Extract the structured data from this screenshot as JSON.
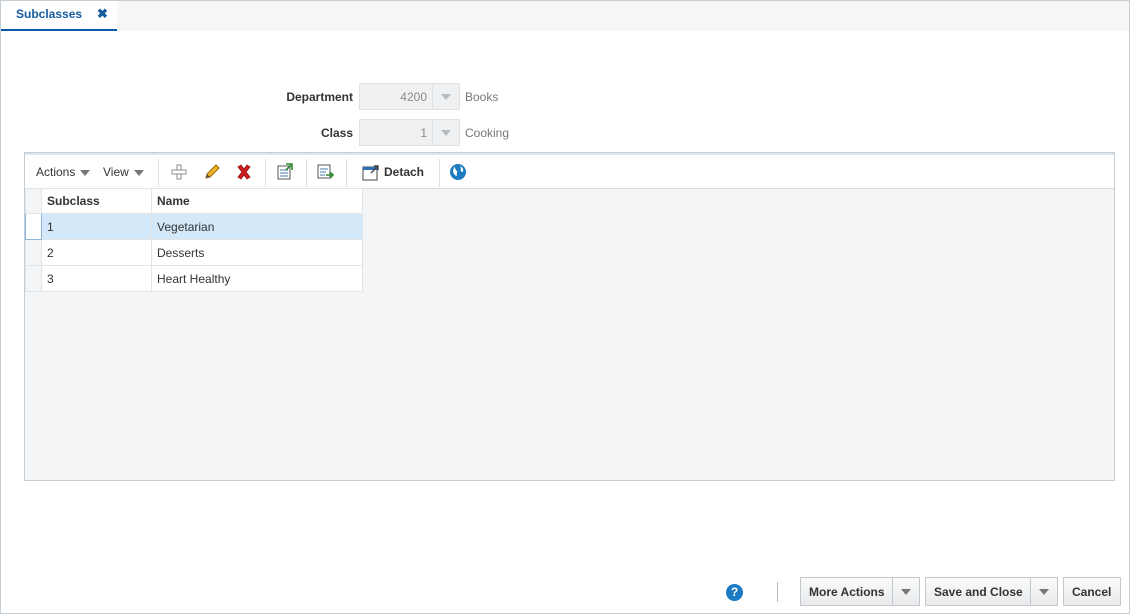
{
  "tab": {
    "label": "Subclasses",
    "close": "✖"
  },
  "form": {
    "department": {
      "label": "Department",
      "value": "4200",
      "description": "Books"
    },
    "class": {
      "label": "Class",
      "value": "1",
      "description": "Cooking"
    }
  },
  "toolbar": {
    "actions_label": "Actions",
    "view_label": "View",
    "detach_label": "Detach",
    "icons": [
      "add-icon",
      "edit-icon",
      "delete-icon",
      "export-icon",
      "import-icon",
      "detach-icon",
      "globe-icon"
    ]
  },
  "table": {
    "columns": [
      "Subclass",
      "Name"
    ],
    "rows": [
      {
        "subclass": "1",
        "name": "Vegetarian"
      },
      {
        "subclass": "2",
        "name": "Desserts"
      },
      {
        "subclass": "3",
        "name": "Heart Healthy"
      }
    ]
  },
  "footer": {
    "help_glyph": "?",
    "more_actions_label": "More Actions",
    "save_close_label": "Save and Close",
    "cancel_label": "Cancel"
  },
  "colors": {
    "accent": "#145c9e",
    "selected_row": "#d3e8f9",
    "delete": "#d01f1f"
  }
}
